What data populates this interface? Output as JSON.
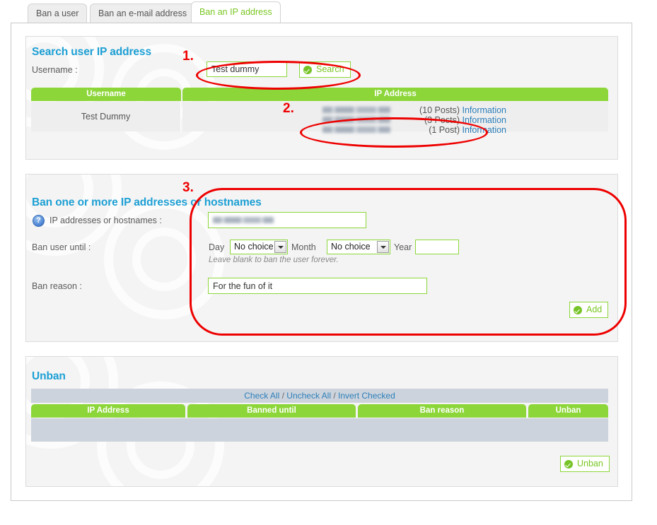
{
  "tabs": [
    {
      "label": "Ban a user",
      "active": false
    },
    {
      "label": "Ban an e-mail address",
      "active": false
    },
    {
      "label": "Ban an IP address",
      "active": true
    }
  ],
  "search_section": {
    "title": "Search user IP address",
    "username_label": "Username :",
    "username_value": "Test dummy",
    "search_button": "Search",
    "table": {
      "headers": [
        "Username",
        "IP Address"
      ],
      "rows": [
        {
          "username": "Test Dummy",
          "ips": [
            {
              "address": "",
              "posts": "(10 Posts)",
              "link": "Information"
            },
            {
              "address": "",
              "posts": "(3 Posts)",
              "link": "Information"
            },
            {
              "address": "",
              "posts": "(1 Post)",
              "link": "Information"
            }
          ]
        }
      ]
    }
  },
  "ban_section": {
    "title": "Ban one or more IP addresses or hostnames",
    "help_icon_text": "?",
    "ip_label": "IP addresses or hostnames :",
    "ip_value": "",
    "until_label": "Ban user until :",
    "day_label": "Day",
    "day_value": "No choice",
    "month_label": "Month",
    "month_value": "No choice",
    "year_label": "Year",
    "year_value": "",
    "forever_hint": "Leave blank to ban the user forever.",
    "reason_label": "Ban reason :",
    "reason_value": "For the fun of it",
    "add_button": "Add"
  },
  "unban_section": {
    "title": "Unban",
    "check_all": "Check All",
    "sep1": "/",
    "uncheck_all": "Uncheck All",
    "sep2": "/",
    "invert_checked": "Invert Checked",
    "headers": [
      "IP Address",
      "Banned until",
      "Ban reason",
      "Unban"
    ],
    "rows": [],
    "unban_button": "Unban"
  },
  "annotations": [
    {
      "number": "1."
    },
    {
      "number": "2."
    },
    {
      "number": "3."
    }
  ],
  "colors": {
    "accent_green": "#8dd63a",
    "heading_blue": "#1c9fd4",
    "link_blue": "#2d7fba",
    "annotation_red": "#ee0000",
    "panel_bg": "#f4f4f4",
    "row_gray": "#ccd3dc"
  }
}
